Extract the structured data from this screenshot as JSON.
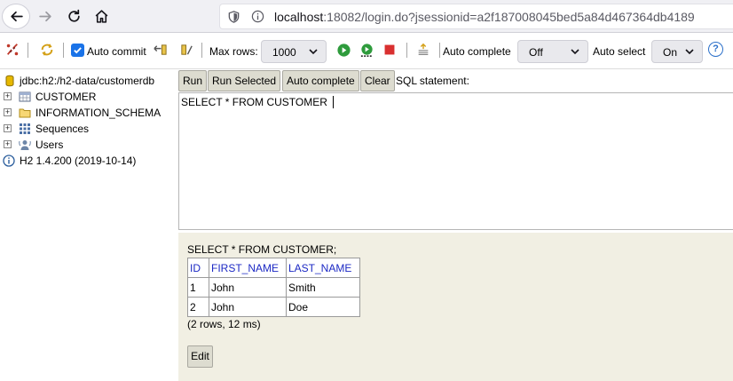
{
  "browser": {
    "url_host": "localhost",
    "url_rest": ":18082/login.do?jsessionid=a2f187008045bed5a84d467364db4189"
  },
  "toolbar": {
    "auto_commit_label": "Auto commit",
    "auto_commit_checked": true,
    "max_rows_label": "Max rows:",
    "max_rows_value": "1000",
    "auto_complete_label": "Auto complete",
    "auto_complete_value": "Off",
    "auto_select_label": "Auto select",
    "auto_select_value": "On",
    "help_glyph": "?"
  },
  "tree": {
    "connection": "jdbc:h2:/h2-data/customerdb",
    "items": [
      {
        "label": "CUSTOMER",
        "icon": "table-icon"
      },
      {
        "label": "INFORMATION_SCHEMA",
        "icon": "folder-icon"
      },
      {
        "label": "Sequences",
        "icon": "sequences-icon"
      },
      {
        "label": "Users",
        "icon": "users-icon"
      }
    ],
    "version": "H2 1.4.200 (2019-10-14)"
  },
  "query": {
    "buttons": [
      "Run",
      "Run Selected",
      "Auto complete",
      "Clear"
    ],
    "sql_label": "SQL statement:",
    "sql_text": "SELECT * FROM CUSTOMER "
  },
  "result": {
    "statement": "SELECT * FROM CUSTOMER;",
    "columns": [
      "ID",
      "FIRST_NAME",
      "LAST_NAME"
    ],
    "rows": [
      [
        "1",
        "John",
        "Smith"
      ],
      [
        "2",
        "John",
        "Doe"
      ]
    ],
    "summary": "(2 rows, 12 ms)",
    "edit_label": "Edit"
  },
  "colors": {
    "result_bg": "#f1efe3",
    "button_bg": "#dddcd0",
    "header_text": "#1c29c4",
    "accent": "#1a73e8"
  }
}
